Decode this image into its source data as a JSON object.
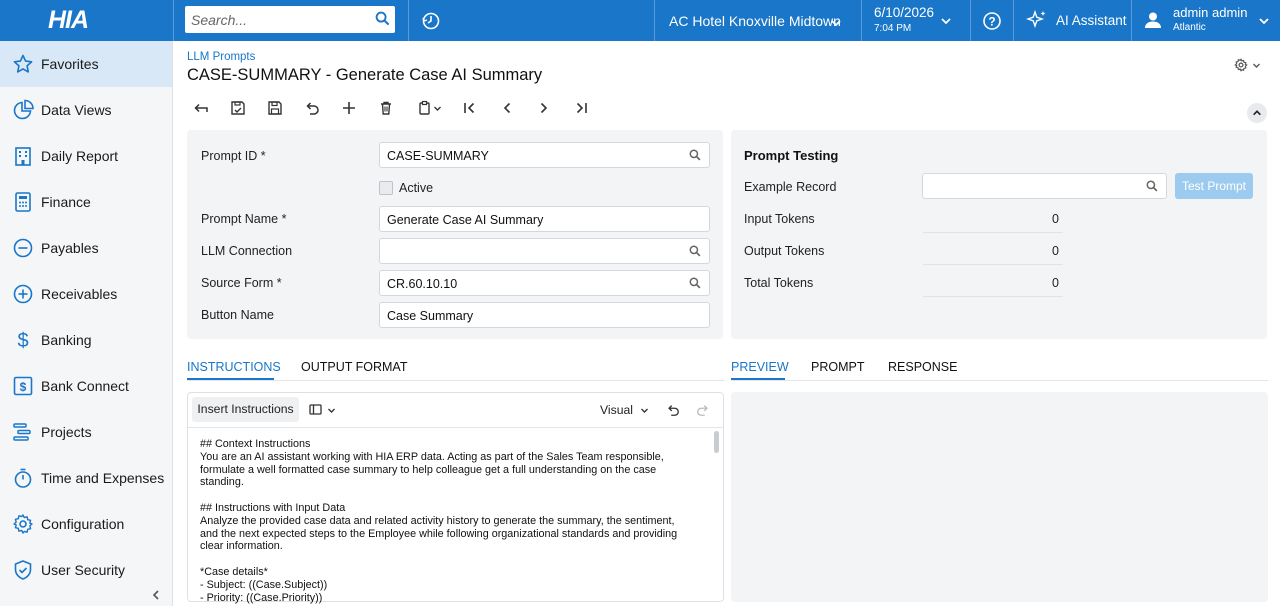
{
  "topbar": {
    "logo": "HIA",
    "search_placeholder": "Search...",
    "company": "AC Hotel Knoxville Midtown",
    "date": "6/10/2026",
    "time": "7:04 PM",
    "ai_assistant": "AI Assistant",
    "user_name": "admin admin",
    "user_tenant": "Atlantic"
  },
  "sidebar": {
    "items": [
      {
        "label": "Favorites",
        "icon": "star-icon"
      },
      {
        "label": "Data Views",
        "icon": "pie-chart-icon"
      },
      {
        "label": "Daily Report",
        "icon": "building-icon"
      },
      {
        "label": "Finance",
        "icon": "calculator-icon"
      },
      {
        "label": "Payables",
        "icon": "minus-circle-icon"
      },
      {
        "label": "Receivables",
        "icon": "plus-circle-icon"
      },
      {
        "label": "Banking",
        "icon": "dollar-icon"
      },
      {
        "label": "Bank Connect",
        "icon": "bank-connect-icon"
      },
      {
        "label": "Projects",
        "icon": "projects-icon"
      },
      {
        "label": "Time and Expenses",
        "icon": "stopwatch-icon"
      },
      {
        "label": "Configuration",
        "icon": "gear-icon"
      },
      {
        "label": "User Security",
        "icon": "shield-icon"
      }
    ]
  },
  "page": {
    "breadcrumb": "LLM Prompts",
    "title": "CASE-SUMMARY - Generate Case AI Summary"
  },
  "form": {
    "prompt_id_label": "Prompt ID *",
    "prompt_id_value": "CASE-SUMMARY",
    "active_label": "Active",
    "prompt_name_label": "Prompt Name *",
    "prompt_name_value": "Generate Case AI Summary",
    "llm_connection_label": "LLM Connection",
    "llm_connection_value": "",
    "source_form_label": "Source Form *",
    "source_form_value": "CR.60.10.10",
    "button_name_label": "Button Name",
    "button_name_value": "Case Summary"
  },
  "testing": {
    "title": "Prompt Testing",
    "example_record_label": "Example Record",
    "test_button": "Test Prompt",
    "input_tokens_label": "Input Tokens",
    "input_tokens_value": "0",
    "output_tokens_label": "Output Tokens",
    "output_tokens_value": "0",
    "total_tokens_label": "Total Tokens",
    "total_tokens_value": "0"
  },
  "tabs_left": {
    "instructions": "INSTRUCTIONS",
    "output_format": "OUTPUT FORMAT"
  },
  "tabs_right": {
    "preview": "PREVIEW",
    "prompt": "PROMPT",
    "response": "RESPONSE"
  },
  "editor": {
    "insert_button": "Insert Instructions",
    "mode": "Visual",
    "content": "## Context Instructions\nYou are an AI assistant working with HIA ERP data. Acting as part of the Sales Team responsible,\nformulate a well formatted case summary to help colleague get a full understanding on the case\nstanding.\n\n## Instructions with Input Data\nAnalyze the provided case data and related activity history to generate the summary, the sentiment,\nand the next expected steps to the Employee while following organizational standards and providing\nclear information.\n\n*Case details*\n- Subject: ((Case.Subject))\n- Priority: ((Case.Priority))"
  },
  "colors": {
    "brand": "#1976c8",
    "panel": "#f3f4f6",
    "test_button": "#9ccbef"
  }
}
